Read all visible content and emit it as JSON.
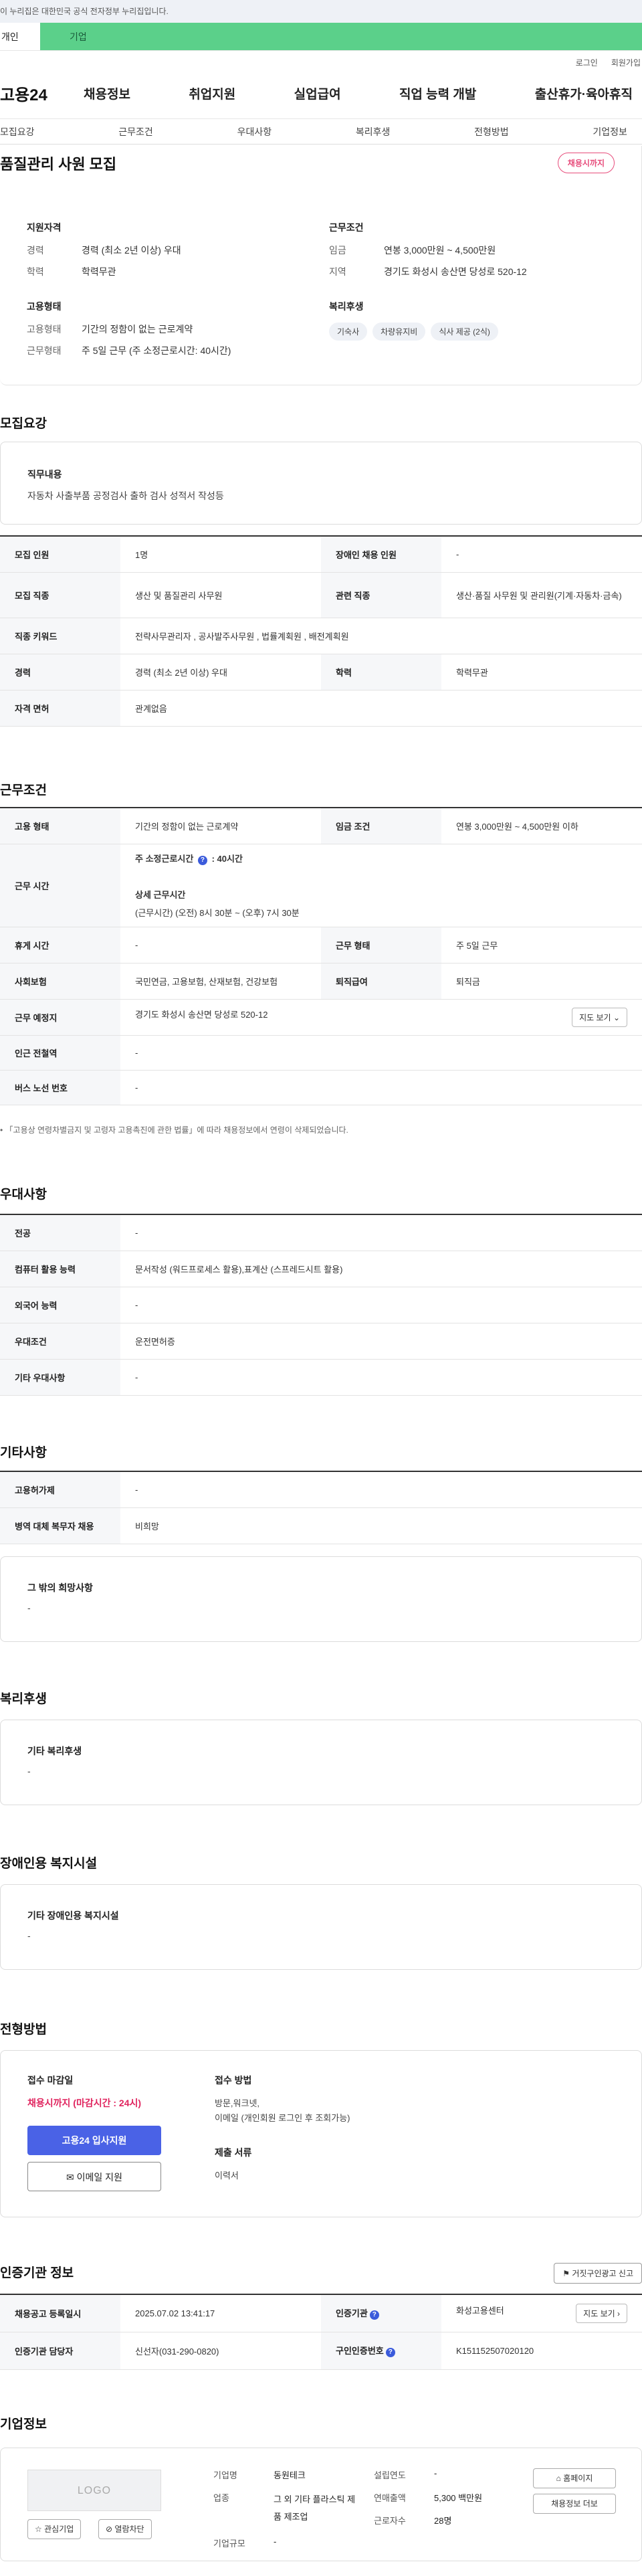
{
  "gov_banner": "이 누리집은 대한민국 공식 전자정부 누리집입니다.",
  "usertabs": {
    "personal": "개인",
    "business": "기업"
  },
  "util": {
    "login": "로그인",
    "join": "회원가입"
  },
  "gnb": {
    "logo": "고용24",
    "items": [
      "채용정보",
      "취업지원",
      "실업급여",
      "직업 능력 개발",
      "출산휴가·육아휴직"
    ]
  },
  "subnav": [
    "모집요강",
    "근무조건",
    "우대사항",
    "복리후생",
    "전형방법",
    "기업정보"
  ],
  "summary": {
    "title": "품질관리 사원 모집",
    "deadline_badge": "채용시까지",
    "qual": {
      "heading": "지원자격",
      "rows": [
        {
          "k": "경력",
          "v": "경력 (최소 2년 이상) 우대"
        },
        {
          "k": "학력",
          "v": "학력무관"
        }
      ]
    },
    "employ": {
      "heading": "고용형태",
      "rows": [
        {
          "k": "고용형태",
          "v": "기간의 정함이 없는 근로계약"
        },
        {
          "k": "근무형태",
          "v": "주 5일 근무 (주 소정근로시간: 40시간)"
        }
      ]
    },
    "cond": {
      "heading": "근무조건",
      "rows": [
        {
          "k": "임금",
          "v": "연봉 3,000만원 ~ 4,500만원"
        },
        {
          "k": "지역",
          "v": "경기도 화성시 송산면 당성로 520-12"
        }
      ]
    },
    "welfare": {
      "heading": "복리후생",
      "chips": [
        "기숙사",
        "차량유지비",
        "식사 제공 (2식)"
      ]
    }
  },
  "recruit": {
    "title": "모집요강",
    "job_label": "직무내용",
    "job_text": "자동차 사출부품 공정검사 출하 검사 성적서 작성등",
    "rows": {
      "count_k": "모집 인원",
      "count_v": "1명",
      "disabled_k": "장애인 채용 인원",
      "disabled_v": "-",
      "job_k": "모집 직종",
      "job_v": "생산 및 품질관리 사무원",
      "rel_k": "관련 직종",
      "rel_v": "생산·품질 사무원 및 관리원(기계·자동차·금속)",
      "kw_k": "직종 키워드",
      "kw_v": "전략사무관리자 , 공사발주사무원 , 법률계획원 , 배전계획원",
      "career_k": "경력",
      "career_v": "경력 (최소 2년 이상) 우대",
      "edu_k": "학력",
      "edu_v": "학력무관",
      "license_k": "자격 면허",
      "license_v": "관계없음"
    }
  },
  "work": {
    "title": "근무조건",
    "type_k": "고용 형태",
    "type_v": "기간의 정함이 없는 근로계약",
    "wage_k": "임금 조건",
    "wage_v": "연봉 3,000만원 ~ 4,500만원 이하",
    "hours_k": "근무 시간",
    "hours_week": "주 소정근로시간",
    "hours_week_v": ": 40시간",
    "hours_detail_label": "상세 근무시간",
    "hours_detail": "(근무시간) (오전) 8시 30분 ~ (오후) 7시 30분",
    "break_k": "휴게 시간",
    "break_v": "-",
    "form_k": "근무 형태",
    "form_v": "주 5일 근무",
    "ins_k": "사회보험",
    "ins_v": "국민연금, 고용보험, 산재보험, 건강보험",
    "sev_k": "퇴직급여",
    "sev_v": "퇴직금",
    "loc_k": "근무 예정지",
    "loc_v": "경기도 화성시 송산면 당성로 520-12",
    "map_btn": "지도 보기",
    "sub_k": "인근 전철역",
    "sub_v": "-",
    "bus_k": "버스 노선 번호",
    "bus_v": "-",
    "note": "「고용상 연령차별금지 및 고령자 고용촉진에 관한 법률」에 따라 채용정보에서 연령이 삭제되었습니다."
  },
  "pref": {
    "title": "우대사항",
    "major_k": "전공",
    "major_v": "-",
    "pc_k": "컴퓨터 활용 능력",
    "pc_v": "문서작성 (워드프로세스 활용),표계산 (스프레드시트 활용)",
    "lang_k": "외국어 능력",
    "lang_v": "-",
    "cond_k": "우대조건",
    "cond_v": "운전면허증",
    "etc_k": "기타 우대사항",
    "etc_v": "-"
  },
  "misc": {
    "title": "기타사항",
    "sub_k": "고용허가제",
    "sub_v": "-",
    "mil_k": "병역 대체 복무자 채용",
    "mil_v": "비희망",
    "other_label": "그 밖의 희망사항",
    "other_v": "-"
  },
  "welfare": {
    "title": "복리후생",
    "label": "기타 복리후생",
    "v": "-"
  },
  "disabled": {
    "title": "장애인용 복지시설",
    "label": "기타 장애인용 복지시설",
    "v": "-"
  },
  "process": {
    "title": "전형방법",
    "deadline_label": "접수 마감일",
    "deadline_v": "채용시까지 (마감시간 : 24시)",
    "apply_btn": "고용24 입사지원",
    "email_btn": "이메일 지원",
    "method_label": "접수 방법",
    "method_v1": "방문,워크넷,",
    "method_v2": "이메일 (개인회원 로그인 후 조회가능)",
    "docs_label": "제출 서류",
    "docs_v": "이력서"
  },
  "agency": {
    "title": "인증기관 정보",
    "report_btn": "거짓구인광고 신고",
    "reg_k": "채용공고 등록일시",
    "reg_v": "2025.07.02 13:41:17",
    "org_k": "인증기관",
    "org_v": "화성고용센터",
    "map_btn": "지도 보기",
    "mgr_k": "인증기관 담당자",
    "mgr_v": "신선자(031-290-0820)",
    "id_k": "구인인증번호",
    "id_v": "K151152507020120"
  },
  "company": {
    "title": "기업정보",
    "logo_text": "LOGO",
    "fav_btn": "관심기업",
    "follow_btn": "열람차단",
    "name_k": "기업명",
    "name_v": "동원테크",
    "industry_k": "업종",
    "industry_v": "그 외 기타 플라스틱 제품 제조업",
    "size_k": "기업규모",
    "size_v": "-",
    "est_k": "설립연도",
    "est_v": "-",
    "sales_k": "연매출액",
    "sales_v": "5,300 백만원",
    "emp_k": "근로자수",
    "emp_v": "28명",
    "home_btn": "홈페이지",
    "more_btn": "채용정보 더보"
  },
  "icons": {
    "info": "info-icon",
    "map": "map-icon",
    "mail": "mail-icon",
    "home": "home-icon",
    "star": "star-icon",
    "block": "block-icon",
    "report": "report-icon"
  }
}
